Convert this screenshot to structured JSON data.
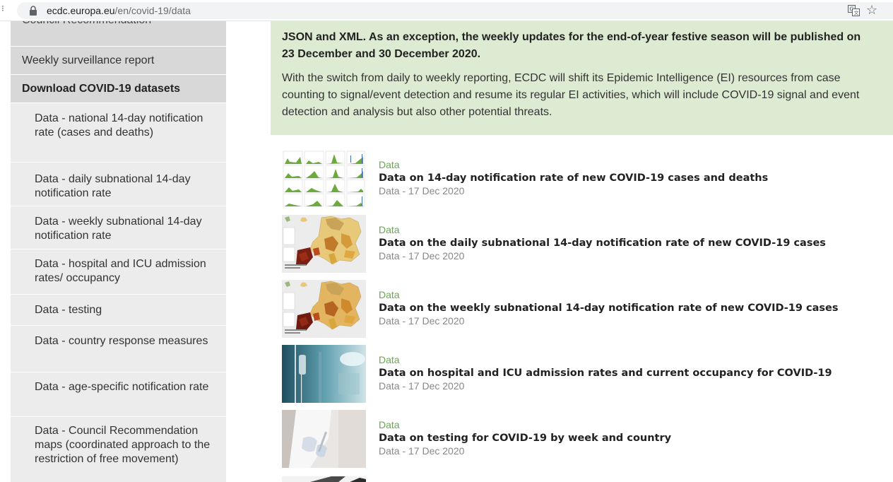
{
  "browser": {
    "url_host": "ecdc.europa.eu",
    "url_path": "/en/covid-19/data"
  },
  "sidebar": {
    "cut_item": "Council Recommendation",
    "weekly_report": "Weekly surveillance report",
    "download_active": "Download COVID-19 datasets",
    "sub_items": [
      "Data - national 14-day notification rate (cases and deaths)",
      "Data - daily subnational 14-day notification rate",
      "Data - weekly subnational 14-day notification rate",
      "Data - hospital and ICU admission rates/ occupancy",
      "Data - testing",
      "Data - country response measures",
      "Data - age-specific notification rate",
      "Data - Council Recommendation maps (coordinated approach to the restriction of free movement)"
    ]
  },
  "notice": {
    "line1": "JSON and XML. As an exception, the weekly updates for the end-of-year festive season will be published on",
    "line2": "23 December and 30 December 2020.",
    "line3": "With the switch from daily to weekly reporting, ECDC will shift its Epidemic Intelligence (EI) resources from case",
    "line4": "counting to signal/event detection and resume its regular EI activities, which will include COVID-19 signal and event",
    "line5": "detection and analysis but also other potential threats."
  },
  "datasets": [
    {
      "category": "Data",
      "title": "Data on 14-day notification rate of new COVID-19 cases and deaths",
      "date": "Data - 17 Dec 2020"
    },
    {
      "category": "Data",
      "title": "Data on the daily subnational 14-day notification rate of new COVID-19 cases",
      "date": "Data - 17 Dec 2020"
    },
    {
      "category": "Data",
      "title": "Data on the weekly subnational 14-day notification rate of new COVID-19 cases",
      "date": "Data - 17 Dec 2020"
    },
    {
      "category": "Data",
      "title": "Data on hospital and ICU admission rates and current occupancy for COVID-19",
      "date": "Data - 17 Dec 2020"
    },
    {
      "category": "Data",
      "title": "Data on testing for COVID-19 by week and country",
      "date": "Data - 17 Dec 2020"
    }
  ],
  "colors": {
    "notice_bg": "#dcebd2",
    "category_green": "#69a84f",
    "sidebar_bg": "#ececec",
    "sidebar_active_bg": "#d8d8d8"
  },
  "icons": [
    "lock-icon",
    "translate-icon",
    "star-icon"
  ]
}
